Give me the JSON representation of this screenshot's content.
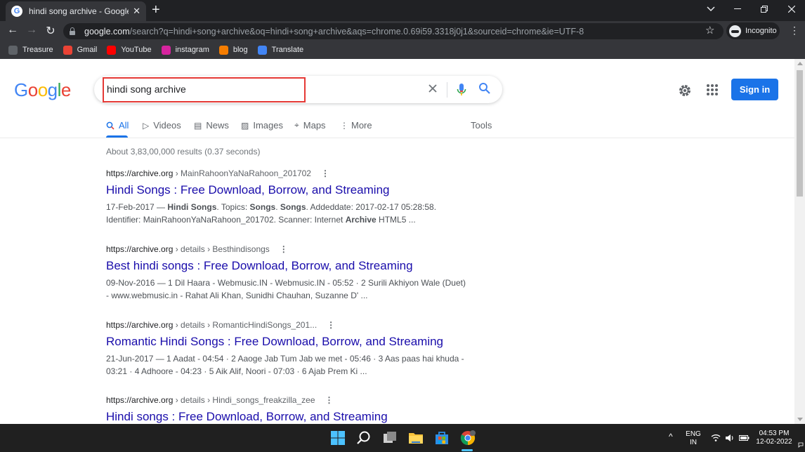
{
  "browser": {
    "tab_title": "hindi song archive - Google Sear",
    "new_tab_symbol": "+",
    "url_host": "google.com",
    "url_rest": "/search?q=hindi+song+archive&oq=hindi+song+archive&aqs=chrome.0.69i59.3318j0j1&sourceid=chrome&ie=UTF-8",
    "incognito_label": "Incognito",
    "bookmarks": [
      {
        "label": "Treasure",
        "icon": "treasure-icon",
        "color": "#5f6368"
      },
      {
        "label": "Gmail",
        "icon": "gmail-icon",
        "color": "#ea4335"
      },
      {
        "label": "YouTube",
        "icon": "youtube-icon",
        "color": "#ff0000"
      },
      {
        "label": "instagram",
        "icon": "instagram-icon",
        "color": "#d6249f"
      },
      {
        "label": "blog",
        "icon": "blogger-icon",
        "color": "#f57d00"
      },
      {
        "label": "Translate",
        "icon": "translate-icon",
        "color": "#4285f4"
      }
    ]
  },
  "google": {
    "logo": "Google",
    "query": "hindi song archive",
    "sign_in": "Sign in",
    "tabs": [
      {
        "label": "All",
        "icon": "search-icon",
        "active": true
      },
      {
        "label": "Videos",
        "icon": "video-icon"
      },
      {
        "label": "News",
        "icon": "news-icon"
      },
      {
        "label": "Images",
        "icon": "image-icon"
      },
      {
        "label": "Maps",
        "icon": "map-pin-icon"
      },
      {
        "label": "More",
        "icon": "more-vert-icon"
      }
    ],
    "tools": "Tools",
    "stats": "About 3,83,00,000 results (0.37 seconds)",
    "results": [
      {
        "site": "https://archive.org",
        "path": " › MainRahoonYaNaRahoon_201702",
        "title": "Hindi Songs : Free Download, Borrow, and Streaming",
        "snippet_line1_parts": [
          "17-Feb-2017 — ",
          "Hindi Songs",
          ". Topics: ",
          "Songs",
          ". ",
          "Songs",
          ". Addeddate: 2017-02-17 05:28:58."
        ],
        "snippet_line2_parts": [
          "Identifier: MainRahoonYaNaRahoon_201702. Scanner: Internet ",
          "Archive",
          " HTML5 ..."
        ]
      },
      {
        "site": "https://archive.org",
        "path": " › details › Besthindisongs",
        "title": "Best hindi songs : Free Download, Borrow, and Streaming",
        "snippet_line1": "09-Nov-2016 — 1 Dil Haara - Webmusic.IN - Webmusic.IN - 05:52 · 2 Surili Akhiyon Wale (Duet)",
        "snippet_line2": "- www.webmusic.in - Rahat Ali Khan, Sunidhi Chauhan, Suzanne D' ..."
      },
      {
        "site": "https://archive.org",
        "path": " › details › RomanticHindiSongs_201...",
        "title": "Romantic Hindi Songs : Free Download, Borrow, and Streaming",
        "snippet_line1": "21-Jun-2017 — 1 Aadat - 04:54 · 2 Aaoge Jab Tum Jab we met - 05:46 · 3 Aas paas hai khuda -",
        "snippet_line2": "03:21 · 4 Adhoore - 04:23 · 5 Aik Alif, Noori - 07:03 · 6 Ajab Prem Ki ..."
      },
      {
        "site": "https://archive.org",
        "path": " › details › Hindi_songs_freakzilla_zee",
        "title": "Hindi songs : Free Download, Borrow, and Streaming"
      }
    ]
  },
  "taskbar": {
    "lang_line1": "ENG",
    "lang_line2": "IN",
    "time": "04:53 PM",
    "date": "12-02-2022",
    "pinned": [
      "windows-start-icon",
      "search-icon",
      "task-view-icon",
      "file-explorer-icon",
      "microsoft-store-icon",
      "chrome-icon"
    ]
  }
}
